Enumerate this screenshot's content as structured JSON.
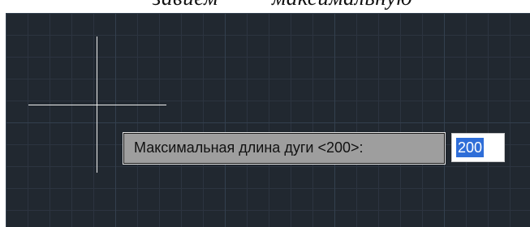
{
  "document": {
    "partial_text_left": "завием",
    "partial_text_right": "максимальную"
  },
  "command_prompt": {
    "label": "Максимальная длина дуги <200>:",
    "input_value": "200"
  }
}
